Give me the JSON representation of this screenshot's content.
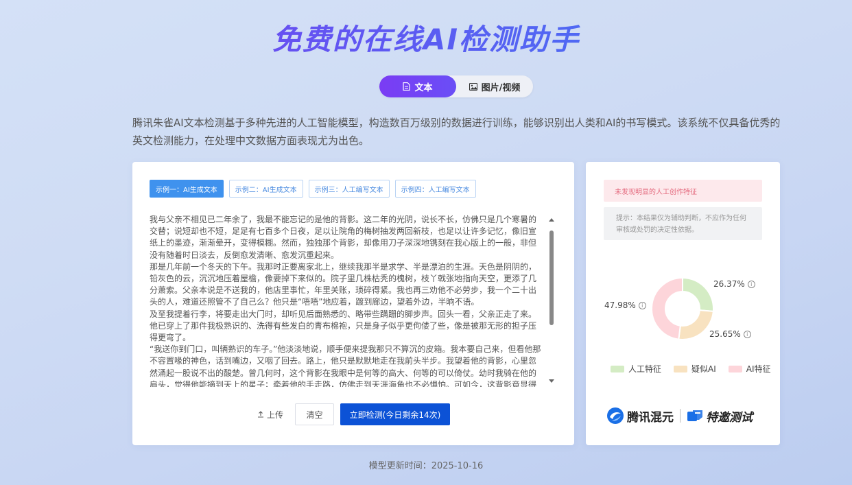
{
  "header": {
    "title": "免费的在线AI检测助手"
  },
  "mode_toggle": {
    "text_label": "文本",
    "image_label": "图片/视频"
  },
  "description": "腾讯朱雀AI文本检测基于多种先进的人工智能模型，构造数百万级别的数据进行训练，能够识别出人类和AI的书写模式。该系统不仅具备优秀的英文检测能力，在处理中文数据方面表现尤为出色。",
  "editor": {
    "examples": [
      "示例一：AI生成文本",
      "示例二：AI生成文本",
      "示例三：人工编写文本",
      "示例四：人工编写文本"
    ],
    "content": "我与父亲不相见已二年余了，我最不能忘记的是他的背影。这二年的光阴，说长不长，仿佛只是几个寒暑的交替；说短却也不短，足足有七百多个日夜，足以让院角的梅树抽发两回新枝，也足以让许多记忆，像旧宣纸上的墨迹，渐渐晕开，变得模糊。然而，独独那个背影，却像用刀子深深地镌刻在我心版上的一般，非但没有随着时日淡去，反倒愈发清晰、愈发沉重起来。\n那是几年前一个冬天的下午。我那时正要离家北上，继续我那半是求学、半是漂泊的生涯。天色是阴阴的，铅灰色的云，沉沉地压着屋檐，像要掉下来似的。院子里几株枯秃的槐树，枝丫戟张地指向天空，更添了几分萧索。父亲本说是不送我的，他店里事忙，年里关账，琐碎得紧。我也再三劝他不必劳步，我一个二十出头的人，难道还照管不了自己么？他只是“唔唔”地应着，踱到廊边，望着外边，半晌不语。\n及至我提着行李，将要走出大门时，却听见后面熟悉的、略带些蹒跚的脚步声。回头一看，父亲正走了来。他已穿上了那件我极熟识的、洗得有些发白的青布棉袍，只是身子似乎更佝偻了些，像是被那无形的担子压得更弯了。\n“我送你到门口，叫辆熟识的车子。”他淡淡地说，顺手便来提我那只不算沉的皮箱。我本要自己来，但看他那不容置喙的神色，话到嘴边，又咽了回去。路上，他只是默默地走在我前头半步。我望着他的背影，心里忽然涌起一股说不出的酸楚。曾几何时，这个背影在我眼中是何等的高大、何等的可以倚仗。幼时我骑在他的肩头，觉得他能摘到天上的星子；牵着他的手走路，仿佛走到天涯海角也不必惧怕。可如今，这背影竟显得这样瘦削，这样落寞了，連那四下里……"
  },
  "actions": {
    "upload_label": "上传",
    "clear_label": "清空",
    "detect_label": "立即检测(今日剩余14次)"
  },
  "result": {
    "alert": "未发现明显的人工创作特征",
    "hint": "提示：本结果仅为辅助判断，不应作为任何审核或处罚的决定性依据。"
  },
  "chart_data": {
    "type": "pie",
    "variant": "donut",
    "slices": [
      {
        "label": "人工特征",
        "value": 26.37,
        "display": "26.37%",
        "color": "#d4ecc4"
      },
      {
        "label": "疑似AI",
        "value": 25.65,
        "display": "25.65%",
        "color": "#f8e2c0"
      },
      {
        "label": "AI特征",
        "value": 47.98,
        "display": "47.98%",
        "color": "#fdd5da"
      }
    ],
    "legend_position": "bottom"
  },
  "brand": {
    "name": "腾讯混元",
    "badge": "特邀测试"
  },
  "footer": {
    "label": "模型更新时间：",
    "date": "2025-10-16"
  }
}
